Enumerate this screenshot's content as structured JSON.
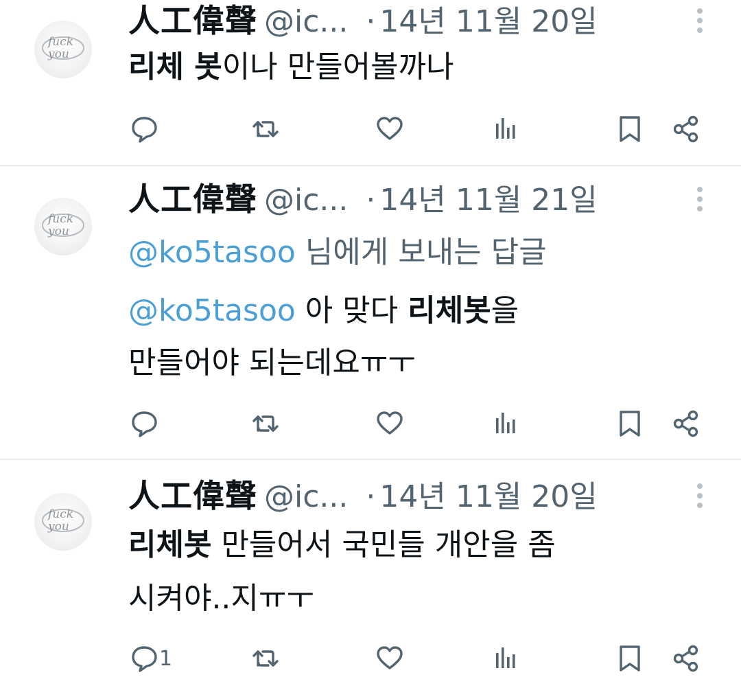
{
  "tweets": [
    {
      "name": "人工偉聲",
      "handle": "@ic...",
      "dot": "·",
      "date": "14년 11월 20일",
      "lines": [
        [
          {
            "t": "리체 봇",
            "s": "bold"
          },
          {
            "t": "이나 만들어볼까나",
            "s": "normal"
          }
        ]
      ],
      "reply_count": ""
    },
    {
      "name": "人工偉聲",
      "handle": "@ic...",
      "dot": "·",
      "date": "14년 11월 21일",
      "lines": [
        [
          {
            "t": "@ko5tasoo",
            "s": "mention"
          },
          {
            "t": " 님에게 보내는 답글",
            "s": "muted"
          }
        ],
        [
          {
            "t": "@ko5tasoo",
            "s": "mention"
          },
          {
            "t": " 아 맞다 ",
            "s": "normal"
          },
          {
            "t": "리체봇",
            "s": "bold"
          },
          {
            "t": "을",
            "s": "normal"
          }
        ],
        [
          {
            "t": "만들어야 되는데요ㅠㅜ",
            "s": "normal"
          }
        ]
      ],
      "reply_count": ""
    },
    {
      "name": "人工偉聲",
      "handle": "@ic...",
      "dot": "·",
      "date": "14년 11월 20일",
      "lines": [
        [
          {
            "t": "리체봇",
            "s": "bold"
          },
          {
            "t": " 만들어서 국민들 개안을 좀",
            "s": "normal"
          }
        ],
        [
          {
            "t": "시켜야..지ㅠㅜ",
            "s": "normal"
          }
        ]
      ],
      "reply_count": "1"
    }
  ],
  "avatar_text": [
    "fuck",
    "you"
  ],
  "colors": {
    "text": "#0f1419",
    "muted": "#536471",
    "mention": "#4a9fd6",
    "divider": "#e7e9ea"
  },
  "icons": [
    "reply-icon",
    "retweet-icon",
    "like-icon",
    "views-icon",
    "bookmark-icon",
    "share-icon",
    "more-icon"
  ]
}
